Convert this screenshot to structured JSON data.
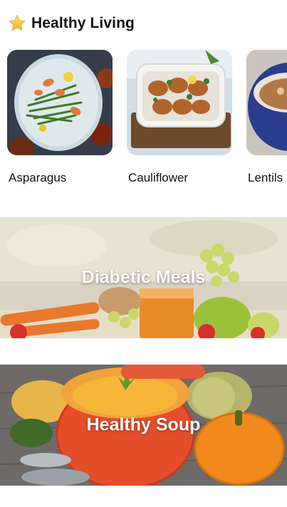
{
  "section": {
    "title": "Healthy Living",
    "icon": "star-icon"
  },
  "carousel": {
    "items": [
      {
        "label": "Asparagus",
        "image": "asparagus-shrimp-plate"
      },
      {
        "label": "Cauliflower",
        "image": "cauliflower-patties-dish"
      },
      {
        "label": "Lentils",
        "image": "lentil-soup-bowl"
      }
    ]
  },
  "banners": [
    {
      "title": "Diabetic Meals",
      "image": "fruits-and-juice"
    },
    {
      "title": "Healthy Soup",
      "image": "pumpkin-soup"
    }
  ]
}
